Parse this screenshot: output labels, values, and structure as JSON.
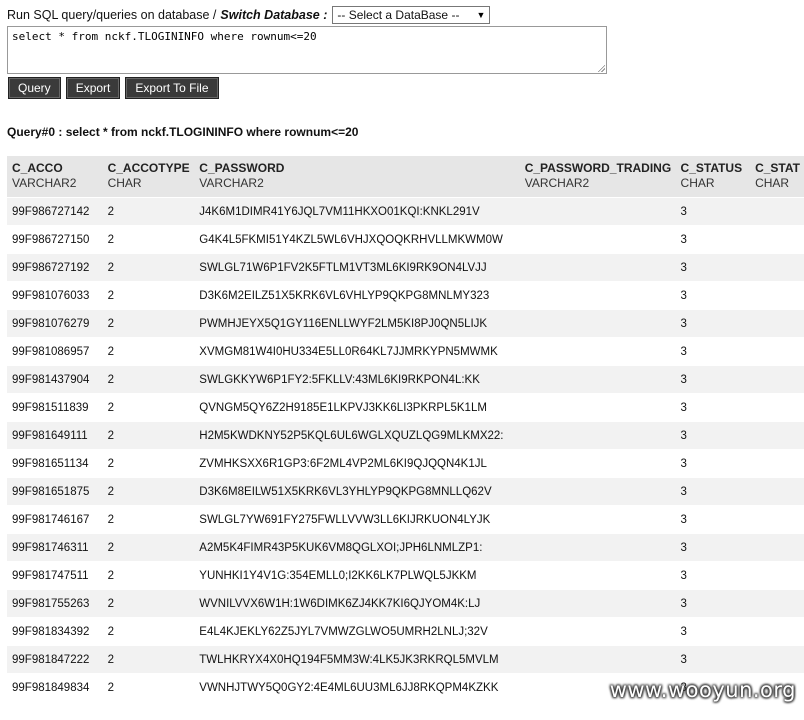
{
  "header": {
    "prompt_label": "Run SQL query/queries on database /",
    "switch_label": "Switch Database :",
    "db_select_value": "-- Select a DataBase --"
  },
  "query": {
    "sql_text": "select * from nckf.TLOGININFO where rownum<=20",
    "query_label": "Query",
    "export_label": "Export",
    "export_file_label": "Export To File",
    "result_title": "Query#0 : select * from nckf.TLOGININFO where rownum<=20"
  },
  "table": {
    "columns": [
      {
        "name": "C_ACCO",
        "type": "VARCHAR2"
      },
      {
        "name": "C_ACCOTYPE",
        "type": "CHAR"
      },
      {
        "name": "C_PASSWORD",
        "type": "VARCHAR2"
      },
      {
        "name": "C_PASSWORD_TRADING",
        "type": "VARCHAR2"
      },
      {
        "name": "C_STATUS",
        "type": "CHAR"
      },
      {
        "name": "C_STAT",
        "type": "CHAR"
      }
    ],
    "rows": [
      [
        "99F986727142",
        "2",
        "J4K6M1DIMR41Y6JQL7VM11HKXO01KQI:KNKL291V",
        "",
        "3",
        ""
      ],
      [
        "99F986727150",
        "2",
        "G4K4L5FKMI51Y4KZL5WL6VHJXQOQKRHVLLMKWM0W",
        "",
        "3",
        ""
      ],
      [
        "99F986727192",
        "2",
        "SWLGL71W6P1FV2K5FTLM1VT3ML6KI9RK9ON4LVJJ",
        "",
        "3",
        ""
      ],
      [
        "99F981076033",
        "2",
        "D3K6M2EILZ51X5KRK6VL6VHLYP9QKPG8MNLMY323",
        "",
        "3",
        ""
      ],
      [
        "99F981076279",
        "2",
        "PWMHJEYX5Q1GY116ENLLWYF2LM5KI8PJ0QN5LIJK",
        "",
        "3",
        ""
      ],
      [
        "99F981086957",
        "2",
        "XVMGM81W4I0HU334E5LL0R64KL7JJMRKYPN5MWMK",
        "",
        "3",
        ""
      ],
      [
        "99F981437904",
        "2",
        "SWLGKKYW6P1FY2:5FKLLV:43ML6KI9RKPON4L:KK",
        "",
        "3",
        ""
      ],
      [
        "99F981511839",
        "2",
        "QVNGM5QY6Z2H9185E1LKPVJ3KK6LI3PKRPL5K1LM",
        "",
        "3",
        ""
      ],
      [
        "99F981649111",
        "2",
        "H2M5KWDKNY52P5KQL6UL6WGLXQUZLQG9MLKMX22:",
        "",
        "3",
        ""
      ],
      [
        "99F981651134",
        "2",
        "ZVMHKSXX6R1GP3:6F2ML4VP2ML6KI9QJQQN4K1JL",
        "",
        "3",
        ""
      ],
      [
        "99F981651875",
        "2",
        "D3K6M8EILW51X5KRK6VL3YHLYP9QKPG8MNLLQ62V",
        "",
        "3",
        ""
      ],
      [
        "99F981746167",
        "2",
        "SWLGL7YW691FY275FWLLVVW3LL6KIJRKUON4LYJK",
        "",
        "3",
        ""
      ],
      [
        "99F981746311",
        "2",
        "A2M5K4FIMR43P5KUK6VM8QGLXOI;JPH6LNMLZP1:",
        "",
        "3",
        ""
      ],
      [
        "99F981747511",
        "2",
        "YUNHKI1Y4V1G:354EMLL0;I2KK6LK7PLWQL5JKKM",
        "",
        "3",
        ""
      ],
      [
        "99F981755263",
        "2",
        "WVNILVVX6W1H:1W6DIMK6ZJ4KK7KI6QJYOM4K:LJ",
        "",
        "3",
        ""
      ],
      [
        "99F981834392",
        "2",
        "E4L4KJEKLY62Z5JYL7VMWZGLWO5UMRH2LNLJ;32V",
        "",
        "3",
        ""
      ],
      [
        "99F981847222",
        "2",
        "TWLHKRYX4X0HQ194F5MM3W:4LK5JK3RKRQL5MVLM",
        "",
        "3",
        ""
      ],
      [
        "99F981849834",
        "2",
        "VWNHJTWY5Q0GY2:4E4ML6UU3ML6JJ8RKQPM4KZKK",
        "",
        "3",
        ""
      ]
    ]
  },
  "watermark": "www.wooyun.org"
}
